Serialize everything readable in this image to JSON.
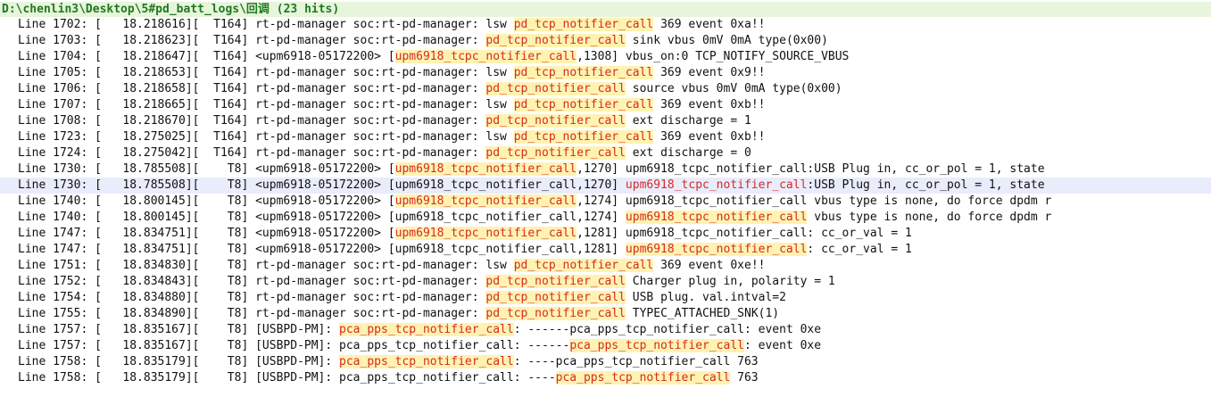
{
  "header": {
    "path": "D:\\chenlin3\\Desktop\\5#pd_batt_logs\\回调",
    "hits": "(23 hits)"
  },
  "lines": [
    {
      "t": "Line 1702: [   18.218616][  T164] rt-pd-manager soc:rt-pd-manager: lsw ",
      "h": "pd_tcp_notifier_call",
      "r": " 369 event 0xa!!"
    },
    {
      "t": "Line 1703: [   18.218623][  T164] rt-pd-manager soc:rt-pd-manager: ",
      "h": "pd_tcp_notifier_call",
      "r": " sink vbus 0mV 0mA type(0x00)"
    },
    {
      "t": "Line 1704: [   18.218647][  T164] <upm6918-05172200> [",
      "h": "upm6918_tcpc_notifier_call",
      "r": ",1308] vbus_on:0 TCP_NOTIFY_SOURCE_VBUS"
    },
    {
      "t": "Line 1705: [   18.218653][  T164] rt-pd-manager soc:rt-pd-manager: lsw ",
      "h": "pd_tcp_notifier_call",
      "r": " 369 event 0x9!!"
    },
    {
      "t": "Line 1706: [   18.218658][  T164] rt-pd-manager soc:rt-pd-manager: ",
      "h": "pd_tcp_notifier_call",
      "r": " source vbus 0mV 0mA type(0x00)"
    },
    {
      "t": "Line 1707: [   18.218665][  T164] rt-pd-manager soc:rt-pd-manager: lsw ",
      "h": "pd_tcp_notifier_call",
      "r": " 369 event 0xb!!"
    },
    {
      "t": "Line 1708: [   18.218670][  T164] rt-pd-manager soc:rt-pd-manager: ",
      "h": "pd_tcp_notifier_call",
      "r": " ext discharge = 1"
    },
    {
      "t": "Line 1723: [   18.275025][  T164] rt-pd-manager soc:rt-pd-manager: lsw ",
      "h": "pd_tcp_notifier_call",
      "r": " 369 event 0xb!!"
    },
    {
      "t": "Line 1724: [   18.275042][  T164] rt-pd-manager soc:rt-pd-manager: ",
      "h": "pd_tcp_notifier_call",
      "r": " ext discharge = 0"
    },
    {
      "t": "Line 1730: [   18.785508][    T8] <upm6918-05172200> [",
      "h": "upm6918_tcpc_notifier_call",
      "r": ",1270] upm6918_tcpc_notifier_call:USB Plug in, cc_or_pol = 1, state"
    },
    {
      "t": "Line 1730: [   18.785508][    T8] <upm6918-05172200> [upm6918_tcpc_notifier_call,1270] ",
      "h": "upm6918_tcpc_notifier_call",
      "r": ":USB Plug in, cc_or_pol = 1, state",
      "sel": true,
      "plain": true
    },
    {
      "t": "Line 1740: [   18.800145][    T8] <upm6918-05172200> [",
      "h": "upm6918_tcpc_notifier_call",
      "r": ",1274] upm6918_tcpc_notifier_call vbus type is none, do force dpdm r"
    },
    {
      "t": "Line 1740: [   18.800145][    T8] <upm6918-05172200> [upm6918_tcpc_notifier_call,1274] ",
      "h": "upm6918_tcpc_notifier_call",
      "r": " vbus type is none, do force dpdm r"
    },
    {
      "t": "Line 1747: [   18.834751][    T8] <upm6918-05172200> [",
      "h": "upm6918_tcpc_notifier_call",
      "r": ",1281] upm6918_tcpc_notifier_call: cc_or_val = 1"
    },
    {
      "t": "Line 1747: [   18.834751][    T8] <upm6918-05172200> [upm6918_tcpc_notifier_call,1281] ",
      "h": "upm6918_tcpc_notifier_call",
      "r": ": cc_or_val = 1"
    },
    {
      "t": "Line 1751: [   18.834830][    T8] rt-pd-manager soc:rt-pd-manager: lsw ",
      "h": "pd_tcp_notifier_call",
      "r": " 369 event 0xe!!"
    },
    {
      "t": "Line 1752: [   18.834843][    T8] rt-pd-manager soc:rt-pd-manager: ",
      "h": "pd_tcp_notifier_call",
      "r": " Charger plug in, polarity = 1"
    },
    {
      "t": "Line 1754: [   18.834880][    T8] rt-pd-manager soc:rt-pd-manager: ",
      "h": "pd_tcp_notifier_call",
      "r": " USB plug. val.intval=2"
    },
    {
      "t": "Line 1755: [   18.834890][    T8] rt-pd-manager soc:rt-pd-manager: ",
      "h": "pd_tcp_notifier_call",
      "r": " TYPEC_ATTACHED_SNK(1)"
    },
    {
      "t": "Line 1757: [   18.835167][    T8] [USBPD-PM]: ",
      "h": "pca_pps_tcp_notifier_call",
      "r": ": ------pca_pps_tcp_notifier_call: event 0xe"
    },
    {
      "t": "Line 1757: [   18.835167][    T8] [USBPD-PM]: pca_pps_tcp_notifier_call: ------",
      "h": "pca_pps_tcp_notifier_call",
      "r": ": event 0xe"
    },
    {
      "t": "Line 1758: [   18.835179][    T8] [USBPD-PM]: ",
      "h": "pca_pps_tcp_notifier_call",
      "r": ": ----pca_pps_tcp_notifier_call 763"
    },
    {
      "t": "Line 1758: [   18.835179][    T8] [USBPD-PM]: pca_pps_tcp_notifier_call: ----",
      "h": "pca_pps_tcp_notifier_call",
      "r": " 763"
    }
  ]
}
